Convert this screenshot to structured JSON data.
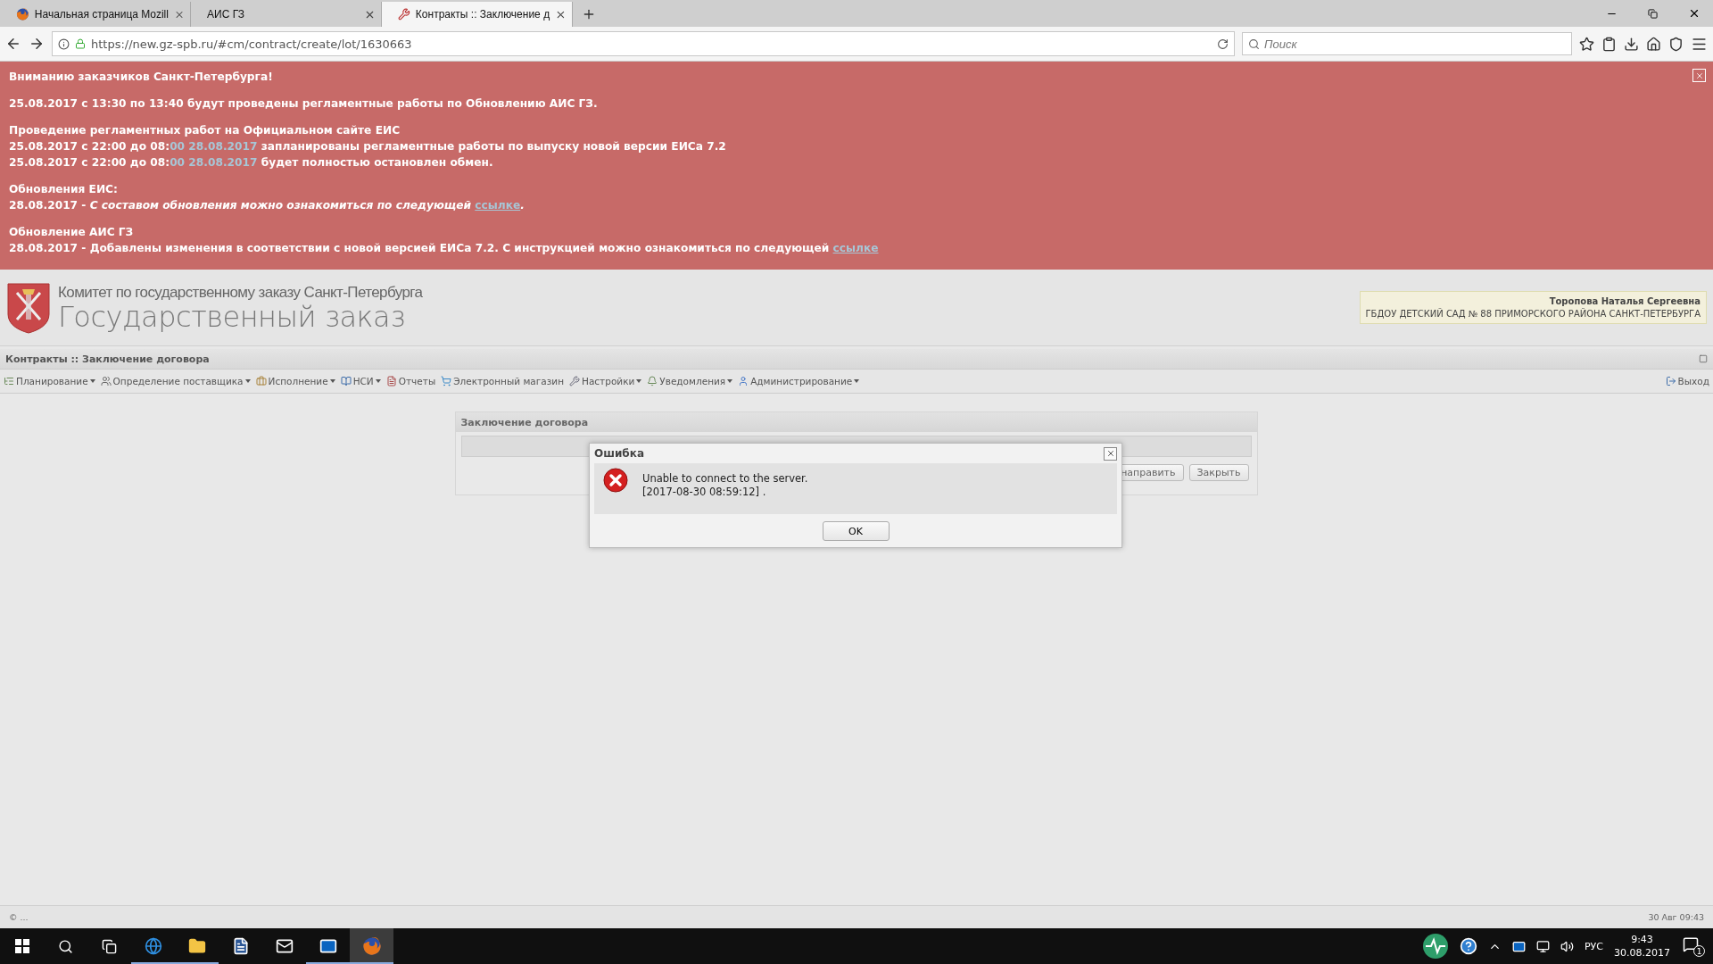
{
  "browser": {
    "tabs": [
      {
        "title": "Начальная страница Mozill",
        "selected": false
      },
      {
        "title": "АИС ГЗ",
        "selected": false
      },
      {
        "title": "Контракты :: Заключение д",
        "selected": true
      }
    ],
    "url": "https://new.gz-spb.ru/#cm/contract/create/lot/1630663",
    "search": {
      "placeholder": "Поиск"
    }
  },
  "banner": {
    "paragraphs": [
      [
        [
          {
            "text": "Вниманию заказчиков Санкт-Петербурга!",
            "kind": "plain"
          }
        ]
      ],
      [
        [
          {
            "text": "25.08.2017 с 13:30 по 13:40 будут проведены регламентные работы по Обновлению АИС ГЗ.",
            "kind": "plain"
          }
        ]
      ],
      [
        [
          {
            "text": "Проведение регламентных работ на Официальном сайте ЕИС",
            "kind": "plain"
          }
        ],
        [
          {
            "text": "25.08.2017 с 22:00 до 08:",
            "kind": "plain"
          },
          {
            "text": "00 28.08.2017",
            "kind": "highlight"
          },
          {
            "text": " запланированы регламентные работы по выпуску новой версии ЕИСа  7.2",
            "kind": "plain"
          }
        ],
        [
          {
            "text": "25.08.2017 с 22:00 до 08:",
            "kind": "plain"
          },
          {
            "text": "00 28.08.2017",
            "kind": "highlight"
          },
          {
            "text": " будет полностью остановлен обмен.",
            "kind": "plain"
          }
        ]
      ],
      [
        [
          {
            "text": "Обновления ЕИС:",
            "kind": "plain"
          }
        ],
        [
          {
            "text": "28.08.2017 - ",
            "kind": "plain"
          },
          {
            "text": "С составом обновления можно ознакомиться по следующей ",
            "kind": "italic"
          },
          {
            "text": "ссылке",
            "kind": "link"
          },
          {
            "text": ".",
            "kind": "italic"
          }
        ]
      ],
      [
        [
          {
            "text": "Обновление АИС ГЗ",
            "kind": "plain"
          }
        ],
        [
          {
            "text": "28.08.2017 - Добавлены изменения в соответствии с новой версией ЕИСа 7.2. С инструкцией можно ознакомиться по следующей ",
            "kind": "plain"
          },
          {
            "text": "ссылке ",
            "kind": "link"
          }
        ]
      ]
    ]
  },
  "header": {
    "committee": "Комитет по государственному заказу Санкт-Петербурга",
    "title": "Государственный заказ",
    "user": {
      "name": "Торопова Наталья Сергеевна",
      "org": "ГБДОУ ДЕТСКИЙ САД № 88 ПРИМОРСКОГО РАЙОНА САНКТ-ПЕТЕРБУРГА"
    }
  },
  "section_title": "Контракты :: Заключение договора",
  "menu": [
    {
      "label": "Планирование",
      "dropdown": true
    },
    {
      "label": "Определение поставщика",
      "dropdown": true
    },
    {
      "label": "Исполнение",
      "dropdown": true
    },
    {
      "label": "НСИ",
      "dropdown": true
    },
    {
      "label": "Отчеты",
      "dropdown": false
    },
    {
      "label": "Электронный магазин",
      "dropdown": false
    },
    {
      "label": "Настройки",
      "dropdown": true
    },
    {
      "label": "Уведомления",
      "dropdown": true
    },
    {
      "label": "Администрирование",
      "dropdown": true
    }
  ],
  "logout": "Выход",
  "panel": {
    "title": "Заключение договора",
    "buttons": [
      "направить",
      "Закрыть"
    ]
  },
  "dialog": {
    "title": "Ошибка",
    "message": [
      "Unable to connect to the server.",
      "[2017-08-30 08:59:12] ."
    ],
    "button": "OK"
  },
  "status_bar": {
    "left": "© ...",
    "right": "30 Авг 09:43"
  },
  "taskbar": {
    "apps": [
      {
        "active": false,
        "running": true
      },
      {
        "active": false,
        "running": true
      },
      {
        "active": false,
        "running": false
      },
      {
        "active": false,
        "running": false
      },
      {
        "active": false,
        "running": true
      },
      {
        "active": true,
        "running": true
      }
    ],
    "language": "РУС",
    "time": "9:43",
    "date": "30.08.2017",
    "notifications": "1"
  }
}
